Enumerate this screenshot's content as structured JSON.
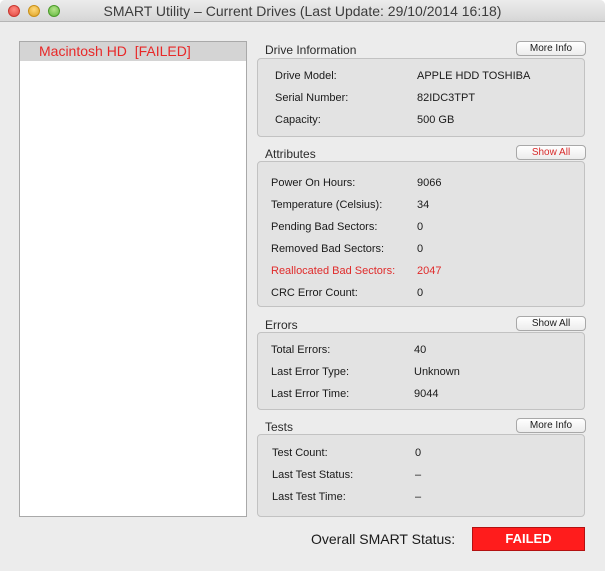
{
  "window": {
    "title": "SMART Utility – Current Drives (Last Update: 29/10/2014 16:18)"
  },
  "drives": [
    {
      "label": "Macintosh HD  [FAILED]"
    }
  ],
  "drive_info": {
    "title": "Drive Information",
    "button": "More Info",
    "rows": [
      {
        "label": "Drive Model:",
        "value": "APPLE HDD TOSHIBA"
      },
      {
        "label": "Serial Number:",
        "value": "82IDC3TPT"
      },
      {
        "label": "Capacity:",
        "value": "500 GB"
      }
    ]
  },
  "attributes": {
    "title": "Attributes",
    "button": "Show All",
    "rows": [
      {
        "label": "Power On Hours:",
        "value": "9066"
      },
      {
        "label": "Temperature (Celsius):",
        "value": "34"
      },
      {
        "label": "Pending Bad Sectors:",
        "value": "0"
      },
      {
        "label": "Removed Bad Sectors:",
        "value": "0"
      },
      {
        "label": "Reallocated Bad Sectors:",
        "value": "2047"
      },
      {
        "label": "CRC Error Count:",
        "value": "0"
      }
    ]
  },
  "errors": {
    "title": "Errors",
    "button": "Show All",
    "rows": [
      {
        "label": "Total Errors:",
        "value": "40"
      },
      {
        "label": "Last Error Type:",
        "value": "Unknown"
      },
      {
        "label": "Last Error Time:",
        "value": "9044"
      }
    ]
  },
  "tests": {
    "title": "Tests",
    "button": "More Info",
    "rows": [
      {
        "label": "Test Count:",
        "value": "0"
      },
      {
        "label": "Last Test Status:",
        "value": "–"
      },
      {
        "label": "Last Test Time:",
        "value": "–"
      }
    ]
  },
  "overall": {
    "label": "Overall SMART Status:",
    "status": "FAILED"
  },
  "colors": {
    "failed_red": "#ff1c1c",
    "warning_text": "#e02b2b"
  }
}
